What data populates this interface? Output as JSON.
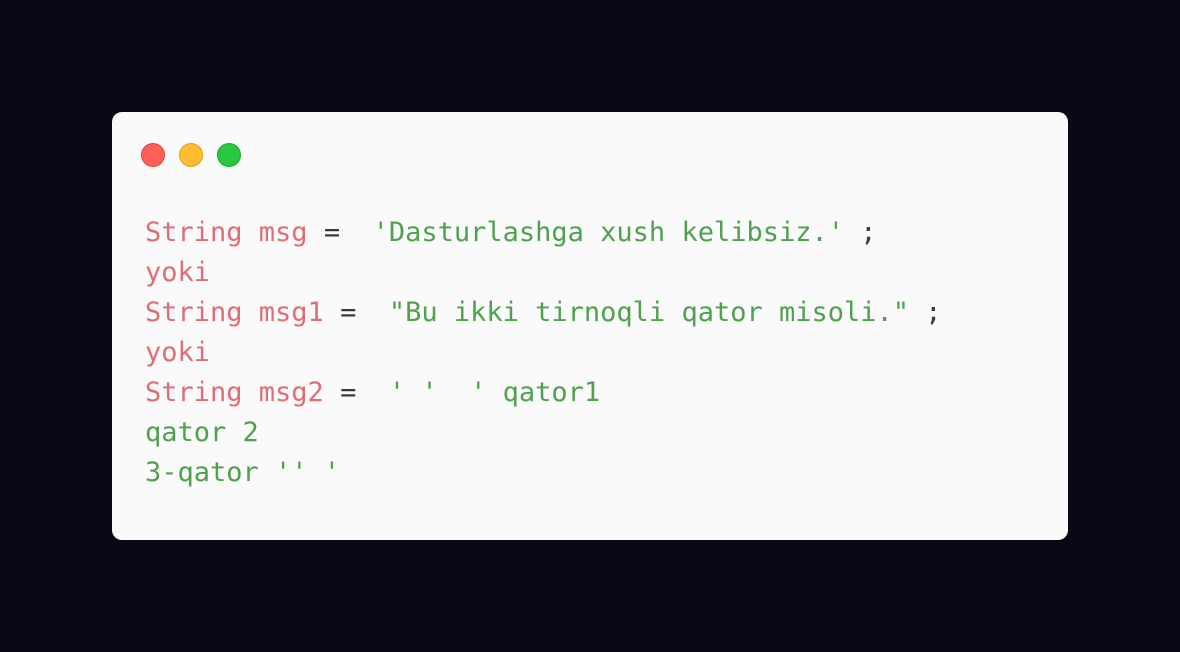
{
  "window": {
    "controls": {
      "close_color": "#ff5f57",
      "minimize_color": "#febc2e",
      "maximize_color": "#28c840"
    }
  },
  "code": {
    "lines": [
      [
        {
          "type": "keyword",
          "text": "String msg"
        },
        {
          "type": "plain",
          "text": " =  "
        },
        {
          "type": "string",
          "text": "'Dasturlashga xush kelibsiz.'"
        },
        {
          "type": "plain",
          "text": " ;"
        }
      ],
      [
        {
          "type": "keyword",
          "text": "yoki"
        }
      ],
      [
        {
          "type": "keyword",
          "text": "String msg1"
        },
        {
          "type": "plain",
          "text": " =  "
        },
        {
          "type": "string",
          "text": "\"Bu ikki tirnoqli qator misoli.\""
        },
        {
          "type": "plain",
          "text": " ;"
        }
      ],
      [
        {
          "type": "keyword",
          "text": "yoki"
        }
      ],
      [
        {
          "type": "keyword",
          "text": "String msg2"
        },
        {
          "type": "plain",
          "text": " =  "
        },
        {
          "type": "string",
          "text": "' '  ' qator1"
        }
      ],
      [
        {
          "type": "string",
          "text": "qator 2"
        }
      ],
      [
        {
          "type": "string",
          "text": "3-qator '' '"
        }
      ]
    ]
  },
  "colors": {
    "page_background": "#0b0816",
    "card_background": "#fafafa",
    "keyword": "#e06c75",
    "string": "#50a14f",
    "plain": "#383a42"
  }
}
